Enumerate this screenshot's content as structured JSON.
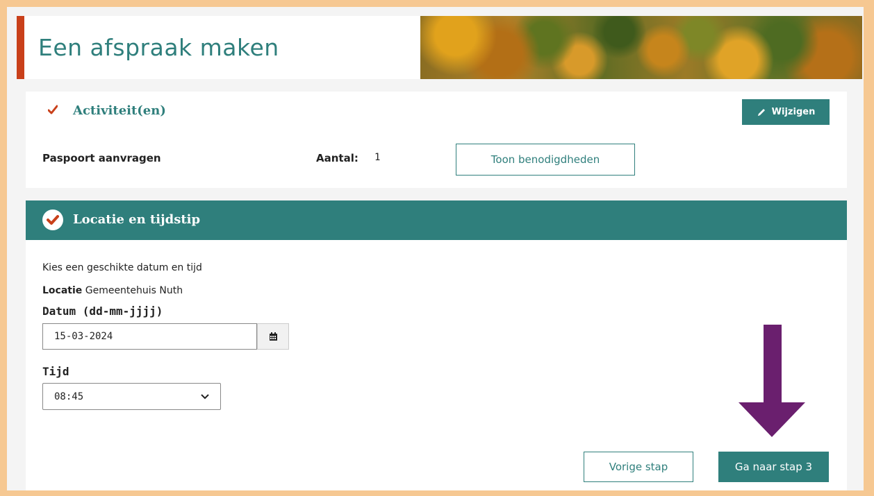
{
  "header": {
    "title": "Een afspraak maken"
  },
  "activities": {
    "title": "Activiteit(en)",
    "edit_label": "Wijzigen",
    "item_name": "Paspoort aanvragen",
    "count_label": "Aantal:",
    "count_value": "1",
    "show_requirements_label": "Toon benodigdheden"
  },
  "location_time": {
    "title": "Locatie en tijdstip",
    "intro": "Kies een geschikte datum en tijd",
    "location_label": "Locatie",
    "location_value": "Gemeentehuis Nuth",
    "date_label": "Datum (dd-mm-jjjj)",
    "date_value": "15-03-2024",
    "time_label": "Tijd",
    "time_value": "08:45"
  },
  "navigation": {
    "previous_label": "Vorige stap",
    "next_label": "Ga naar stap 3"
  },
  "colors": {
    "brand_teal": "#2f7f7c",
    "accent_red": "#c9401a",
    "frame_peach": "#f6c892",
    "annotation_arrow": "#6a1f6e"
  },
  "icons": {
    "section_complete": "check-icon",
    "edit": "pencil-icon",
    "calendar": "calendar-icon",
    "select": "chevron-down-icon",
    "annotation": "arrow-down-icon"
  }
}
